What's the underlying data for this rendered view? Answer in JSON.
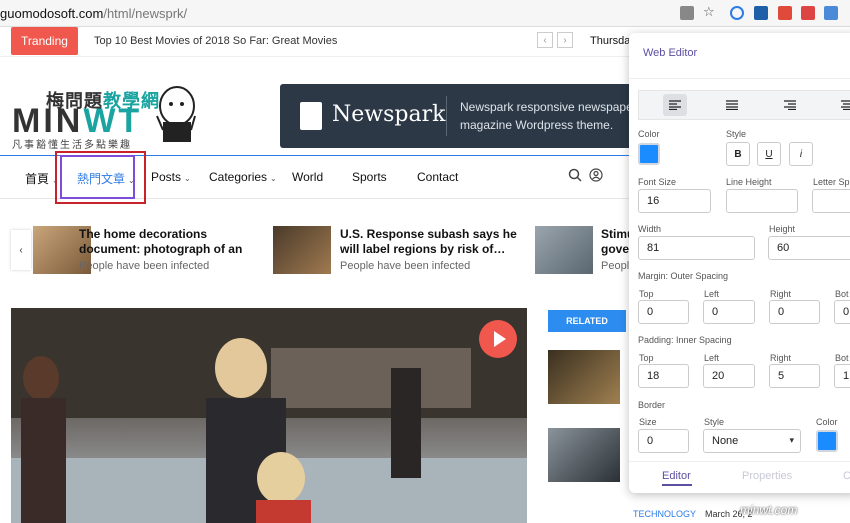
{
  "browser": {
    "url_host": "guomodosoft.com",
    "url_path": "/html/newsprk/"
  },
  "trending": {
    "badge": "Tranding",
    "headline": "Top 10 Best Movies of 2018 So Far: Great Movies",
    "prev": "‹",
    "next": "›",
    "date": "Thursday"
  },
  "header": {
    "logo_zh_a": "梅問題",
    "logo_zh_b": "教學網",
    "logo_en_a": "MIN",
    "logo_en_b": "WT",
    "logo_sub": "凡事豁懂生活多點樂趣",
    "banner_brand": "Newspark",
    "banner_tagline": "Newspark responsive newspaper magazine Wordpress theme."
  },
  "nav": {
    "items": [
      {
        "label": "首頁",
        "caret": "⌄"
      },
      {
        "label": "熱門文章",
        "caret": "⌄"
      },
      {
        "label": "Posts",
        "caret": "⌄"
      },
      {
        "label": "Categories",
        "caret": "⌄"
      },
      {
        "label": "World",
        "caret": ""
      },
      {
        "label": "Sports",
        "caret": ""
      },
      {
        "label": "Contact",
        "caret": ""
      }
    ]
  },
  "ticker": {
    "prev": "‹",
    "articles": [
      {
        "title": "The home decorations document: photograph of an",
        "meta": "People have been infected"
      },
      {
        "title": "U.S. Response subash says he will label regions by risk of…",
        "meta": "People have been infected"
      },
      {
        "title": "Stimu gover",
        "meta": "People"
      }
    ]
  },
  "sidebar": {
    "related_label": "RELATED",
    "footer_tag": "TECHNOLOGY",
    "footer_date": "March 26, 2"
  },
  "watermark": "minwt.com",
  "editor": {
    "title": "Web Editor",
    "color_label": "Color",
    "style_label": "Style",
    "style_buttons": [
      "B",
      "U",
      "i"
    ],
    "font_size_label": "Font Size",
    "font_size": "16",
    "line_height_label": "Line Height",
    "line_height": "",
    "letter_spacing_label": "Letter Sp",
    "width_label": "Width",
    "width": "81",
    "height_label": "Height",
    "height": "60",
    "margin_label": "Margin: Outer Spacing",
    "margin": {
      "top_label": "Top",
      "top": "0",
      "left_label": "Left",
      "left": "0",
      "right_label": "Right",
      "right": "0",
      "bottom_label": "Bot",
      "bottom": "0"
    },
    "padding_label": "Padding: Inner Spacing",
    "padding": {
      "top_label": "Top",
      "top": "18",
      "left_label": "Left",
      "left": "20",
      "right_label": "Right",
      "right": "5",
      "bottom_label": "Bot",
      "bottom": "1"
    },
    "border_label": "Border",
    "border_size_label": "Size",
    "border_size": "0",
    "border_style_label": "Style",
    "border_style": "None",
    "border_color_label": "Color",
    "tabs": [
      "Editor",
      "Properties",
      "C"
    ],
    "accent_color": "#1a8cff"
  }
}
